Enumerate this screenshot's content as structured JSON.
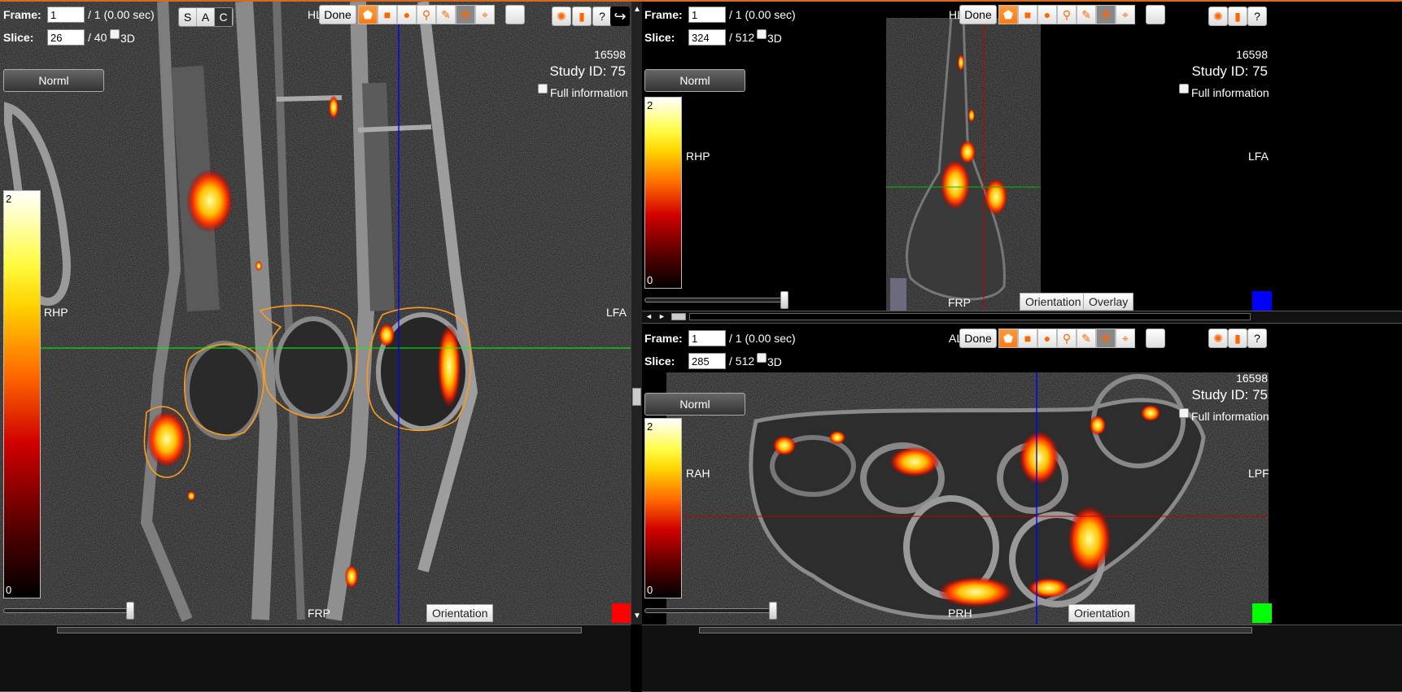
{
  "views": {
    "left": {
      "frame_label": "Frame:",
      "frame_value": "1",
      "frame_total": "/ 1 (0.00 sec)",
      "slice_label": "Slice:",
      "slice_value": "26",
      "slice_total": "/ 40",
      "three_d_label": "3D",
      "hl_label": "HL",
      "done_label": "Done",
      "sac": [
        "S",
        "A",
        "C"
      ],
      "norml_label": "Norml",
      "colorbar_max": "2",
      "colorbar_min": "0",
      "study_number": "16598",
      "study_id": "Study ID: 75",
      "full_info_label": "Full information",
      "orient_left": "RHP",
      "orient_right": "LFA",
      "orient_bottom": "FRP",
      "orientation_button": "Orientation",
      "indicator_color": "#ff0000"
    },
    "top_right": {
      "frame_label": "Frame:",
      "frame_value": "1",
      "frame_total": "/ 1 (0.00 sec)",
      "slice_label": "Slice:",
      "slice_value": "324",
      "slice_total": "/ 512",
      "three_d_label": "3D",
      "hl_label": "HL",
      "done_label": "Done",
      "norml_label": "Norml",
      "colorbar_max": "2",
      "colorbar_min": "0",
      "study_number": "16598",
      "study_id": "Study ID: 75",
      "full_info_label": "Full information",
      "orient_left": "RHP",
      "orient_right": "LFA",
      "orient_bottom": "FRP",
      "orientation_button": "Orientation",
      "overlay_button": "Overlay",
      "indicator_color": "#0000ff"
    },
    "bottom_right": {
      "frame_label": "Frame:",
      "frame_value": "1",
      "frame_total": "/ 1 (0.00 sec)",
      "slice_label": "Slice:",
      "slice_value": "285",
      "slice_total": "/ 512",
      "three_d_label": "3D",
      "hl_label": "AL",
      "done_label": "Done",
      "norml_label": "Norml",
      "colorbar_max": "2",
      "colorbar_min": "0",
      "study_number": "16598",
      "study_id": "Study ID: 75",
      "full_info_label": "Full information",
      "orient_left": "RAH",
      "orient_right": "LPF",
      "orient_bottom": "PRH",
      "orientation_button": "Orientation",
      "indicator_color": "#00ff00"
    }
  },
  "tool_icons": [
    "pentagon-icon",
    "square-icon",
    "circle-icon",
    "magnifier-icon",
    "pencil-icon",
    "move-cross-icon",
    "crosshair-icon",
    "blank-icon"
  ],
  "accent": "#ff6600",
  "toolbar_icons": [
    "palette-icon",
    "histogram-icon",
    "help-icon",
    "export-icon"
  ],
  "help_glyph": "?"
}
